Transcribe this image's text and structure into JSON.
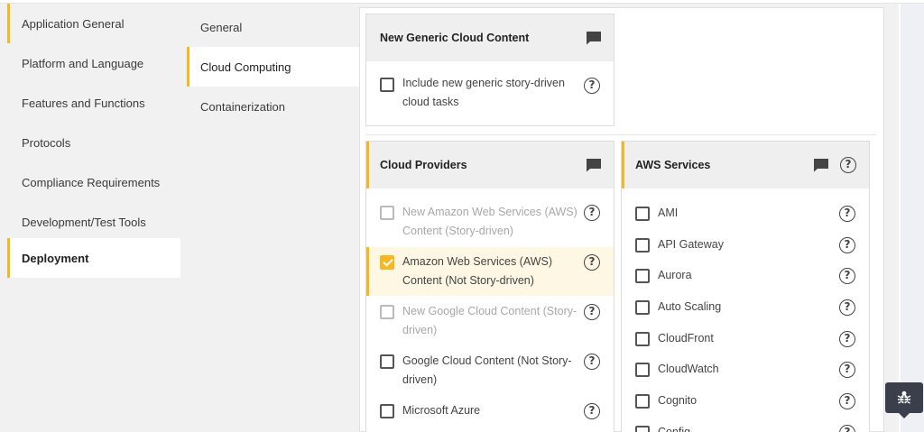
{
  "left_nav": {
    "items": [
      {
        "label": "Application General"
      },
      {
        "label": "Platform and Language"
      },
      {
        "label": "Features and Functions"
      },
      {
        "label": "Protocols"
      },
      {
        "label": "Compliance Requirements"
      },
      {
        "label": "Development/Test Tools"
      },
      {
        "label": "Deployment",
        "active": true
      }
    ]
  },
  "sub_nav": {
    "items": [
      {
        "label": "General"
      },
      {
        "label": "Cloud Computing",
        "active": true
      },
      {
        "label": "Containerization"
      }
    ]
  },
  "generic_panel": {
    "title": "New Generic Cloud Content",
    "items": [
      {
        "label_line1": "Include new generic story-driven",
        "label_line2": "cloud tasks",
        "checked": false
      }
    ]
  },
  "providers_panel": {
    "title": "Cloud Providers",
    "items": [
      {
        "label_line1": "New Amazon Web Services (AWS)",
        "label_line2": "Content (Story-driven)",
        "checked": false,
        "disabled": true
      },
      {
        "label_line1": "Amazon Web Services (AWS)",
        "label_line2": "Content (Not Story-driven)",
        "checked": true,
        "disabled": false
      },
      {
        "label_line1": "New Google Cloud Content (Story-",
        "label_line2": "driven)",
        "checked": false,
        "disabled": true
      },
      {
        "label_line1": "Google Cloud Content (Not Story-",
        "label_line2": "driven)",
        "checked": false,
        "disabled": false
      },
      {
        "label_line1": "Microsoft Azure",
        "label_line2": "",
        "checked": false,
        "disabled": false
      }
    ]
  },
  "aws_panel": {
    "title": "AWS Services",
    "items": [
      {
        "label": "AMI"
      },
      {
        "label": "API Gateway"
      },
      {
        "label": "Aurora"
      },
      {
        "label": "Auto Scaling"
      },
      {
        "label": "CloudFront"
      },
      {
        "label": "CloudWatch"
      },
      {
        "label": "Cognito"
      },
      {
        "label": "Config"
      }
    ]
  },
  "icons": {
    "comment": "comment-icon",
    "help": "help-icon",
    "bug": "bug-icon"
  },
  "colors": {
    "accent": "#f5b820",
    "panel_header": "#efefef",
    "bug_button": "#3a3f4b"
  }
}
